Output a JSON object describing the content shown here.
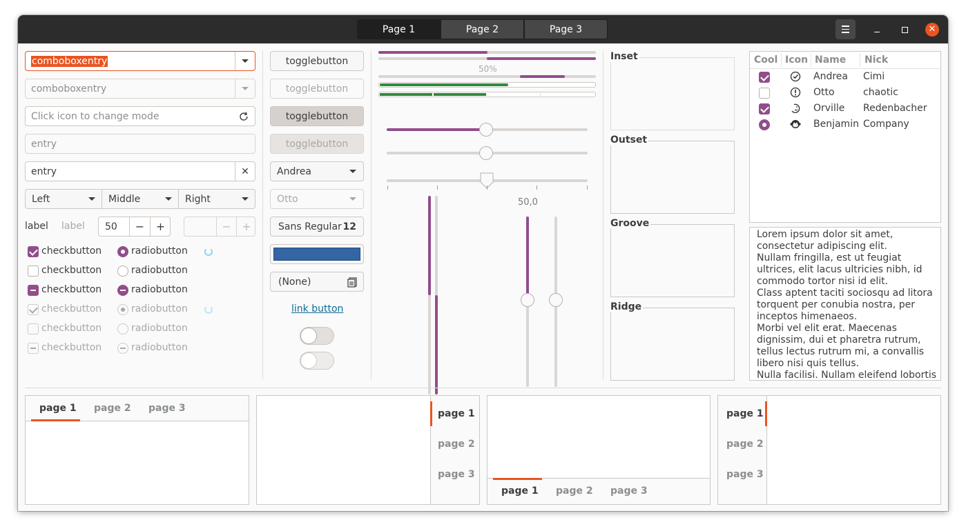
{
  "titlebar": {
    "tabs": [
      "Page 1",
      "Page 2",
      "Page 3"
    ],
    "active_tab": "Page 1",
    "close_glyph": "✕"
  },
  "column1": {
    "combo_entry_1": "comboboxentry",
    "combo_entry_2": "comboboxentry",
    "icon_entry_placeholder": "Click icon to change mode",
    "entry_disabled_placeholder": "entry",
    "entry_value": "entry",
    "clear_glyph": "✕",
    "linked_buttons": [
      "Left",
      "Middle",
      "Right"
    ],
    "label_1": "label",
    "label_2": "label",
    "spin_value": "50",
    "spin_minus": "−",
    "spin_plus": "+",
    "checkbutton_label": "checkbutton",
    "radiobutton_label": "radiobutton"
  },
  "column2": {
    "togglebuttons": [
      "togglebutton",
      "togglebutton",
      "togglebutton",
      "togglebutton"
    ],
    "combo_1": "Andrea",
    "combo_2": "Otto",
    "font_name": "Sans Regular",
    "font_size": "12",
    "color_value": "#3465a4",
    "file_chooser": "(None)",
    "link_button": "link button"
  },
  "column3": {
    "progress_text": "50%",
    "scale_value_label": "50,0",
    "progress_values": [
      0.5,
      0.5,
      0.65,
      0.6,
      0.5
    ],
    "h_scale_values": [
      0.5,
      0.5,
      0.5
    ],
    "v_progress_values": [
      0.5,
      0.5
    ],
    "v_scale_values": [
      0.5,
      0.5
    ]
  },
  "frames": {
    "inset": "Inset",
    "outset": "Outset",
    "groove": "Groove",
    "ridge": "Ridge"
  },
  "treeview": {
    "headers": [
      "Cool",
      "Icon",
      "Name",
      "Nick"
    ],
    "rows": [
      {
        "name": "Andrea",
        "nick": "Cimi",
        "icon": "check-circle-icon"
      },
      {
        "name": "Otto",
        "nick": "chaotic",
        "icon": "exclamation-circle-icon"
      },
      {
        "name": "Orville",
        "nick": "Redenbacher",
        "icon": "moon-face-icon"
      },
      {
        "name": "Benjamin",
        "nick": "Company",
        "icon": "monkey-icon"
      }
    ]
  },
  "textview": {
    "lines": [
      "Lorem ipsum dolor sit amet,",
      "consectetur adipiscing elit.",
      "Nullam fringilla, est ut feugiat",
      "ultrices, elit lacus ultricies nibh, id",
      "commodo tortor nisi id elit.",
      "Class aptent taciti sociosqu ad litora",
      "torquent per conubia nostra, per",
      "inceptos himenaeos.",
      "Morbi vel elit erat. Maecenas",
      "dignissim, dui et pharetra rutrum,",
      "tellus lectus rutrum mi, a convallis",
      "libero nisi quis tellus.",
      "Nulla facilisi. Nullam eleifend lobortis"
    ]
  },
  "notebooks": {
    "tabs": [
      "page 1",
      "page 2",
      "page 3"
    ]
  },
  "colors": {
    "accent": "#e95420",
    "check": "#924d8b",
    "titlebar": "#2c2c2c",
    "link": "#0e6a96"
  }
}
